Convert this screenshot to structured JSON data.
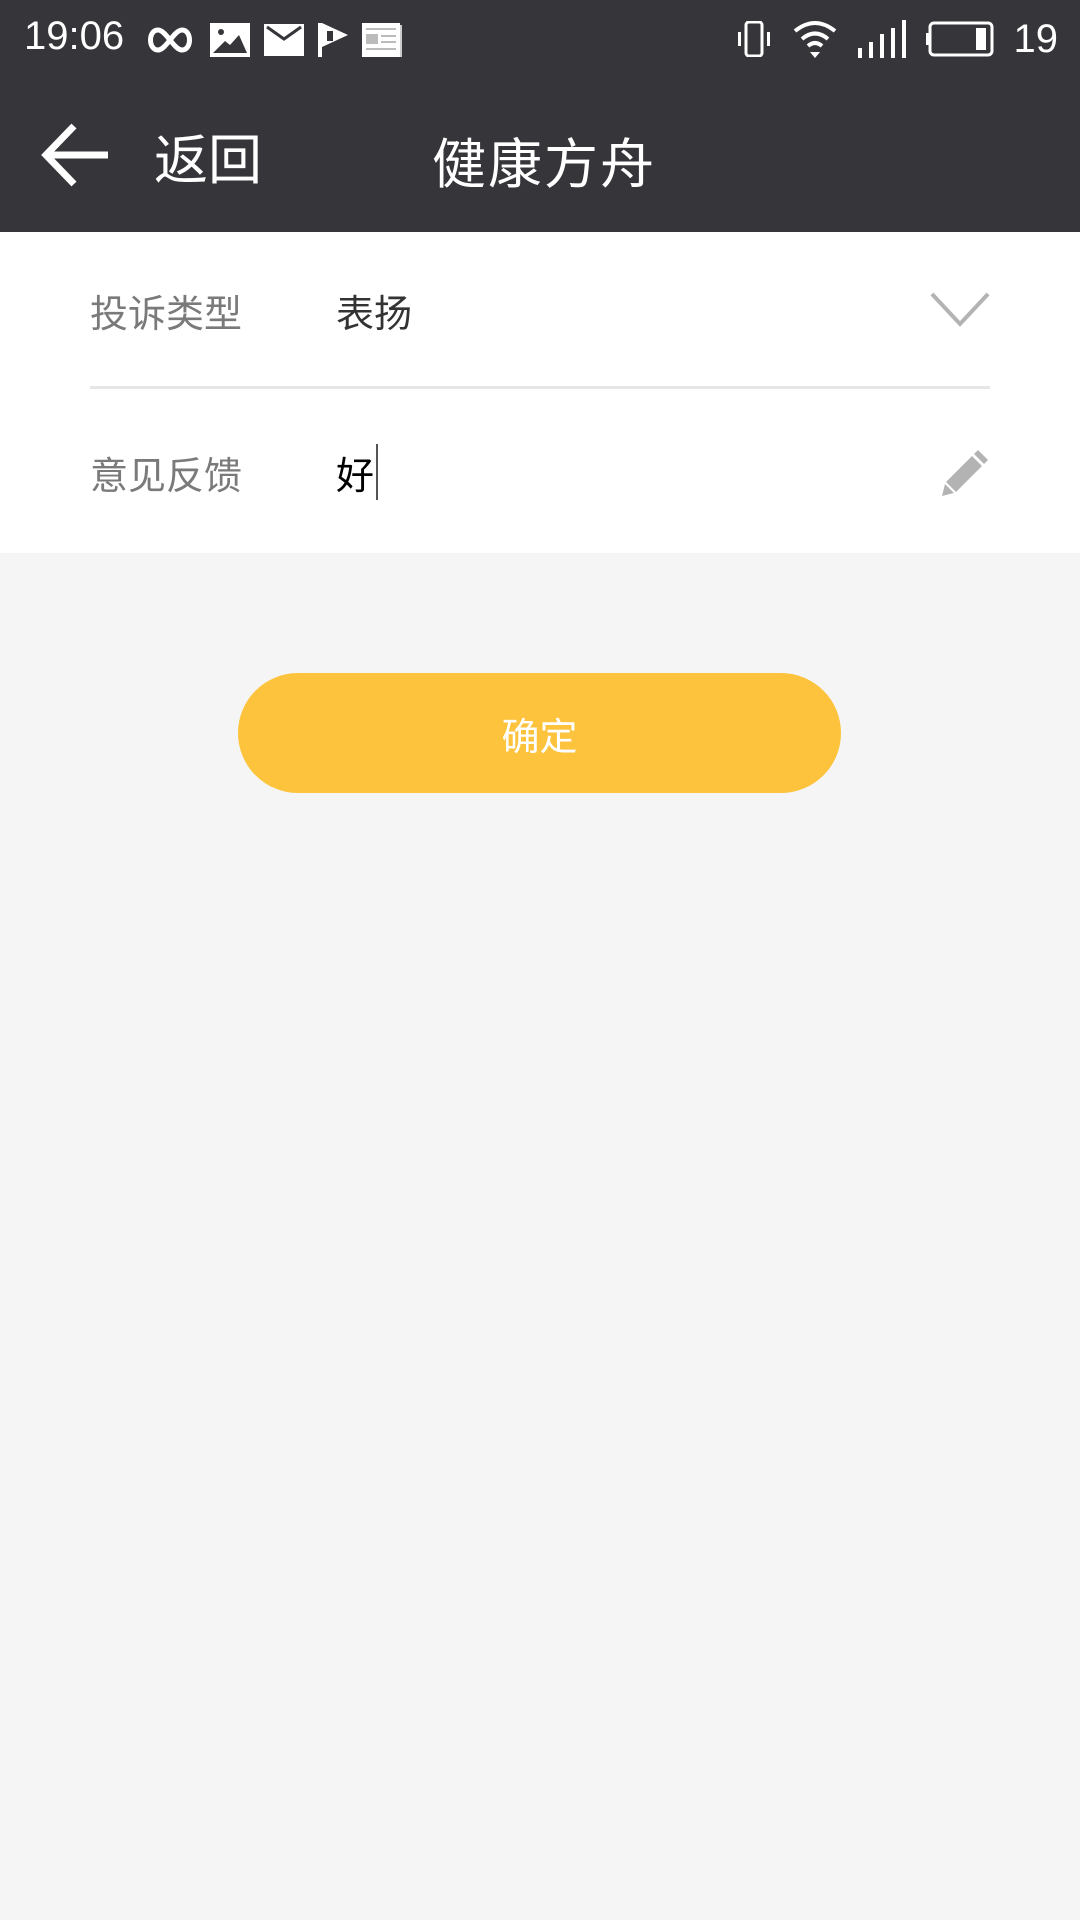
{
  "status_bar": {
    "time": "19:06",
    "left_icons": [
      "infinity-icon",
      "image-icon",
      "mail-icon",
      "flag-icon",
      "news-icon"
    ],
    "right_icons": [
      "vibrate-icon",
      "wifi-icon",
      "signal-icon",
      "battery-icon"
    ],
    "battery_level": "19"
  },
  "nav": {
    "back_label": "返回",
    "title": "健康方舟"
  },
  "form": {
    "complaint_type": {
      "label": "投诉类型",
      "value": "表扬"
    },
    "feedback": {
      "label": "意见反馈",
      "value": "好"
    }
  },
  "actions": {
    "confirm_label": "确定"
  },
  "colors": {
    "header_bg": "#36353a",
    "accent": "#fdc33c",
    "page_bg": "#f5f5f5"
  }
}
